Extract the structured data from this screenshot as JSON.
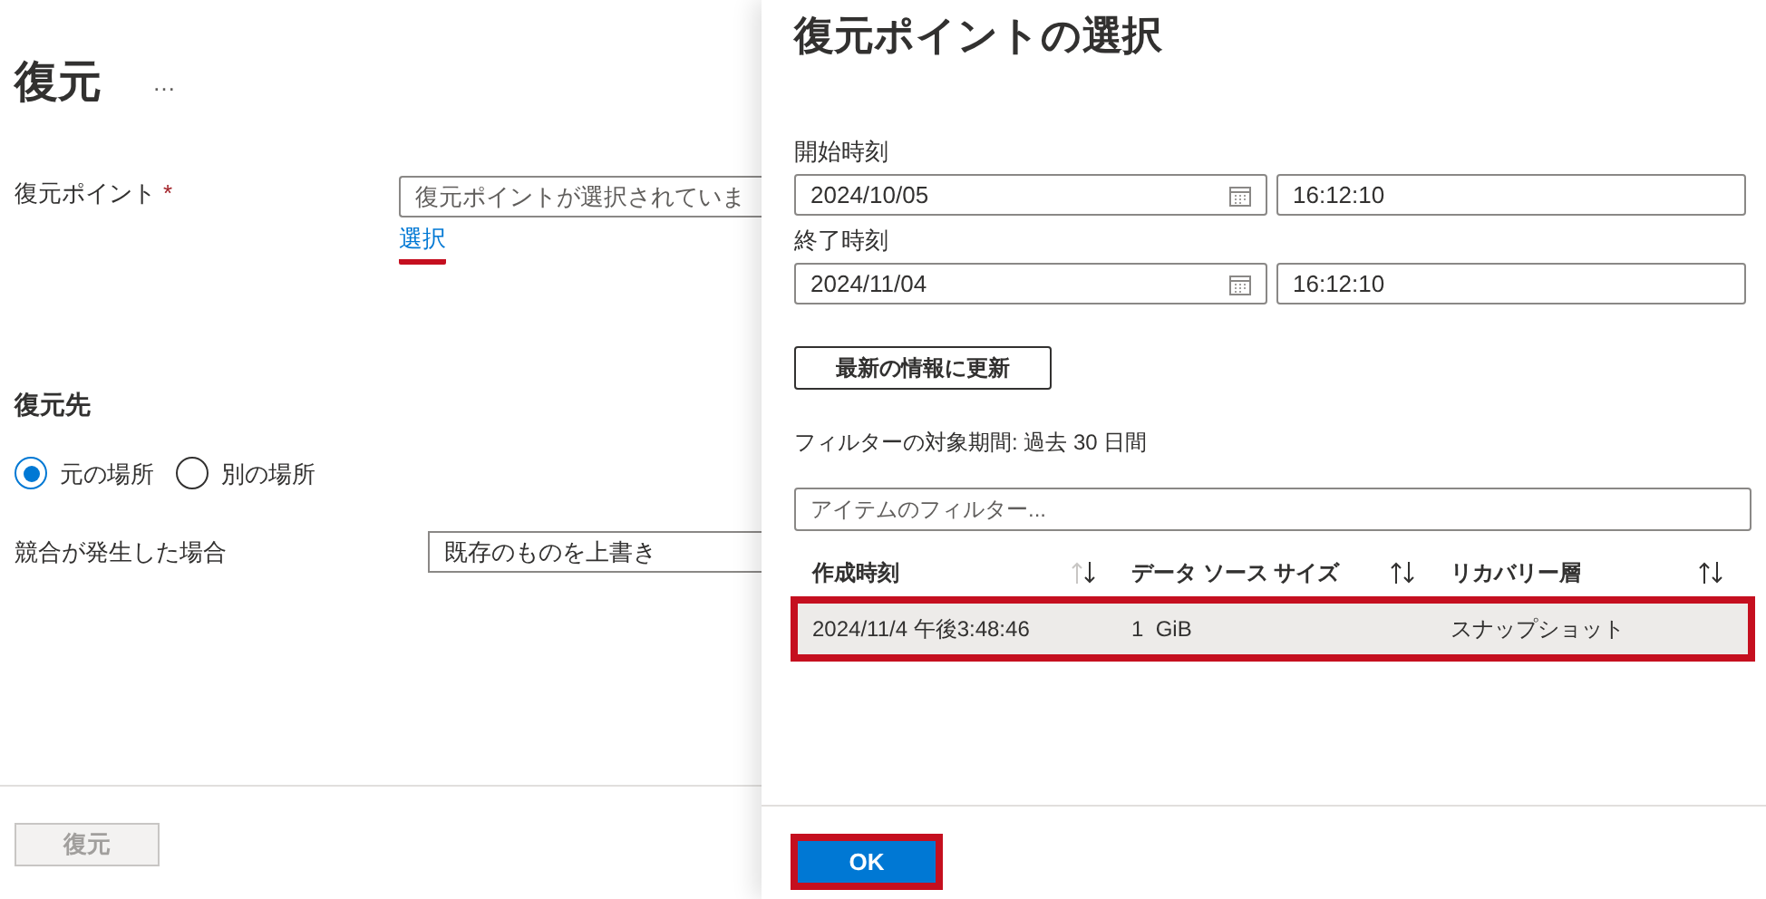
{
  "restore_page": {
    "title": "復元",
    "more": "…",
    "restore_point": {
      "label": "復元ポイント",
      "required": "*",
      "placeholder": "復元ポイントが選択されていま",
      "link": "選択",
      "highlighted": true
    },
    "destination": {
      "heading": "復元先",
      "options": [
        {
          "label": "元の場所",
          "selected": true
        },
        {
          "label": "別の場所",
          "selected": false
        }
      ]
    },
    "conflict": {
      "label": "競合が発生した場合",
      "value": "既存のものを上書き"
    },
    "restore_button": {
      "label": "復元",
      "disabled": true
    }
  },
  "panel": {
    "title": "復元ポイントの選択",
    "start": {
      "label": "開始時刻",
      "date": "2024/10/05",
      "time": "16:12:10"
    },
    "end": {
      "label": "終了時刻",
      "date": "2024/11/04",
      "time": "16:12:10"
    },
    "refresh_button": "最新の情報に更新",
    "filter_period": "フィルターの対象期間: 過去 30 日間",
    "filter": {
      "placeholder": "アイテムのフィルター..."
    },
    "table": {
      "columns": [
        {
          "label": "作成時刻",
          "sorted": true
        },
        {
          "label": "データ ソース サイズ",
          "sorted": false
        },
        {
          "label": "リカバリー層",
          "sorted": false
        }
      ],
      "rows": [
        {
          "cells": [
            "2024/11/4 午後3:48:46",
            "1  GiB",
            "スナップショット"
          ],
          "selected": true,
          "highlighted": true
        }
      ]
    },
    "ok_button": {
      "label": "OK",
      "highlighted": true
    }
  }
}
